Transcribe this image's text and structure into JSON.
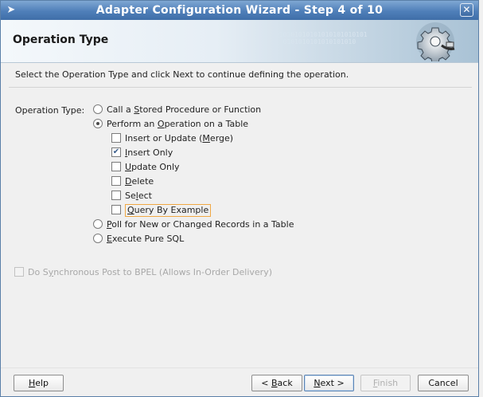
{
  "window": {
    "title": "Adapter Configuration Wizard - Step 4 of 10",
    "icon": "arrow-icon"
  },
  "header": {
    "title": "Operation Type",
    "banner_binary": "010101010101010101010101\n  0101010101010101010",
    "banner_icon": "gear-plug-icon"
  },
  "instruction": "Select the Operation Type and click Next to continue defining the operation.",
  "operation": {
    "label": "Operation Type:",
    "options": [
      {
        "pre": "Call a ",
        "mn": "S",
        "post": "tored Procedure or Function",
        "selected": false
      },
      {
        "pre": "Perform an ",
        "mn": "O",
        "post": "peration on a Table",
        "selected": true
      },
      {
        "pre": "",
        "mn": "P",
        "post": "oll for New or Changed Records in a Table",
        "selected": false
      },
      {
        "pre": "",
        "mn": "E",
        "post": "xecute Pure SQL",
        "selected": false
      }
    ],
    "table_ops": [
      {
        "pre": "Insert or Update (",
        "mn": "M",
        "post": "erge)",
        "checked": false
      },
      {
        "pre": "",
        "mn": "I",
        "post": "nsert Only",
        "checked": true
      },
      {
        "pre": "",
        "mn": "U",
        "post": "pdate Only",
        "checked": false
      },
      {
        "pre": "",
        "mn": "D",
        "post": "elete",
        "checked": false
      },
      {
        "pre": "Se",
        "mn": "l",
        "post": "ect",
        "checked": false
      },
      {
        "pre": "",
        "mn": "Q",
        "post": "uery By Example",
        "checked": false
      }
    ]
  },
  "sync_post": {
    "pre": "Do S",
    "mn": "y",
    "post": "nchronous Post to BPEL (Allows In-Order Delivery)",
    "checked": false,
    "enabled": false
  },
  "buttons": {
    "help": {
      "pre": "",
      "mn": "H",
      "post": "elp"
    },
    "back": {
      "pre": "< ",
      "mn": "B",
      "post": "ack"
    },
    "next": {
      "pre": "",
      "mn": "N",
      "post": "ext >"
    },
    "finish": {
      "pre": "",
      "mn": "F",
      "post": "inish"
    },
    "cancel": {
      "pre": "Cancel",
      "mn": "",
      "post": ""
    }
  },
  "colors": {
    "titlebar": "#4f7fb9",
    "focus_outline": "#f0a844",
    "check_mark": "#3b5f8c"
  }
}
